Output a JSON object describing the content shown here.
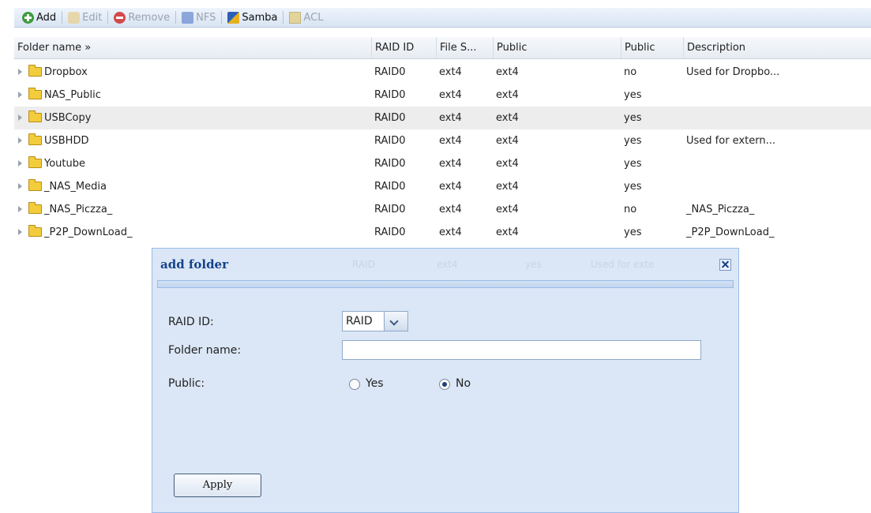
{
  "toolbar": {
    "add": "Add",
    "edit": "Edit",
    "remove": "Remove",
    "nfs": "NFS",
    "samba": "Samba",
    "acl": "ACL"
  },
  "grid": {
    "columns": [
      "Folder name »",
      "RAID ID",
      "File S...",
      "Public",
      "Public",
      "Description"
    ],
    "rows": [
      {
        "name": "Dropbox",
        "raid": "RAID0",
        "fs": "ext4",
        "col4": "ext4",
        "public": "no",
        "desc": "Used for Dropbo..."
      },
      {
        "name": "NAS_Public",
        "raid": "RAID0",
        "fs": "ext4",
        "col4": "ext4",
        "public": "yes",
        "desc": ""
      },
      {
        "name": "USBCopy",
        "raid": "RAID0",
        "fs": "ext4",
        "col4": "ext4",
        "public": "yes",
        "desc": ""
      },
      {
        "name": "USBHDD",
        "raid": "RAID0",
        "fs": "ext4",
        "col4": "ext4",
        "public": "yes",
        "desc": "Used for extern..."
      },
      {
        "name": "Youtube",
        "raid": "RAID0",
        "fs": "ext4",
        "col4": "ext4",
        "public": "yes",
        "desc": ""
      },
      {
        "name": "_NAS_Media",
        "raid": "RAID0",
        "fs": "ext4",
        "col4": "ext4",
        "public": "yes",
        "desc": ""
      },
      {
        "name": "_NAS_Piczza_",
        "raid": "RAID0",
        "fs": "ext4",
        "col4": "ext4",
        "public": "no",
        "desc": "_NAS_Piczza_"
      },
      {
        "name": "_P2P_DownLoad_",
        "raid": "RAID0",
        "fs": "ext4",
        "col4": "ext4",
        "public": "yes",
        "desc": "_P2P_DownLoad_"
      }
    ]
  },
  "dialog": {
    "title": "add folder",
    "ghost_row": [
      "RAID",
      "ext4",
      "yes",
      "Used for exte"
    ],
    "raid_label": "RAID ID:",
    "raid_value": "RAID",
    "folder_label": "Folder name:",
    "folder_value": "",
    "public_label": "Public:",
    "yes_label": "Yes",
    "no_label": "No",
    "public_selected": "No",
    "apply": "Apply"
  }
}
